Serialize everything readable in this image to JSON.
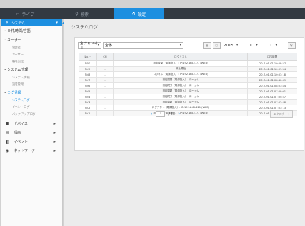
{
  "topbar": {
    "tabs": [
      {
        "label": "ライブ",
        "icon": "monitor-icon"
      },
      {
        "label": "検索",
        "icon": "search-icon"
      },
      {
        "label": "設定",
        "icon": "gear-icon",
        "active": true
      }
    ]
  },
  "sidebar": {
    "header": "システム",
    "sections": [
      {
        "label": "日付/時間/言語",
        "items": []
      },
      {
        "label": "ユーザー",
        "items": [
          "管理者",
          "ユーザー",
          "権限設定"
        ]
      },
      {
        "label": "システム管理",
        "items": [
          "システム情報",
          "設定管理"
        ]
      },
      {
        "label": "ログ情報",
        "items": [
          "システムログ",
          "イベントログ",
          "バックアップログ"
        ]
      }
    ],
    "categories": [
      {
        "label": "デバイス",
        "icon": "camera-icon"
      },
      {
        "label": "録画",
        "icon": "record-icon"
      },
      {
        "label": "イベント",
        "icon": "event-icon"
      },
      {
        "label": "ネットワーク",
        "icon": "network-icon"
      }
    ]
  },
  "main": {
    "title": "システムログ",
    "filters": {
      "channel": "全チャンネル",
      "type": "全体",
      "year": "2015",
      "month": "1",
      "day": "1"
    },
    "table": {
      "headers": [
        "No.",
        "CH",
        "ログリスト",
        "ログ時間"
      ],
      "rows": [
        [
          "550",
          "-",
          "設定変更（電源投入）: IP:192.168.4.21 (WEB)",
          "2015-01-01 10:08:57"
        ],
        [
          "549",
          "-",
          "停止開始",
          "2015-01-01 10:07:54"
        ],
        [
          "548",
          "-",
          "ログイン（電源投入）: IP:192.168.4.21 (WEB)",
          "2015-01-01 10:03:18"
        ],
        [
          "547",
          "-",
          "設定変更（電源投入）: ローカル",
          "2015-01-01 08:40:49"
        ],
        [
          "546",
          "-",
          "設定終了（電源投入）: ローカル",
          "2015-01-01 08:03:44"
        ],
        [
          "545",
          "-",
          "設定変更（電源投入）: ローカル",
          "2015-01-01 07:09:01"
        ],
        [
          "544",
          "-",
          "設定終了（電源投入）: ローカル",
          "2015-01-01 07:04:57"
        ],
        [
          "543",
          "-",
          "設定変更（電源投入）: ローカル",
          "2015-01-01 07:03:48"
        ],
        [
          "542",
          "-",
          "ログアウト（電源投入）: IP:192.168.4.21 (WEB)",
          "2015-01-01 07:03:13"
        ],
        [
          "541",
          "-",
          "設定変更（電源投入）: IP:192.168.4.21 (WEB)",
          "2015-01-01 07:03:13"
        ]
      ]
    },
    "pager": {
      "page": "1",
      "total": "/ 55"
    },
    "export_label": "エクスポート",
    "colors": {
      "accent": "#1d8fe0",
      "topbar": "#333a42"
    }
  }
}
